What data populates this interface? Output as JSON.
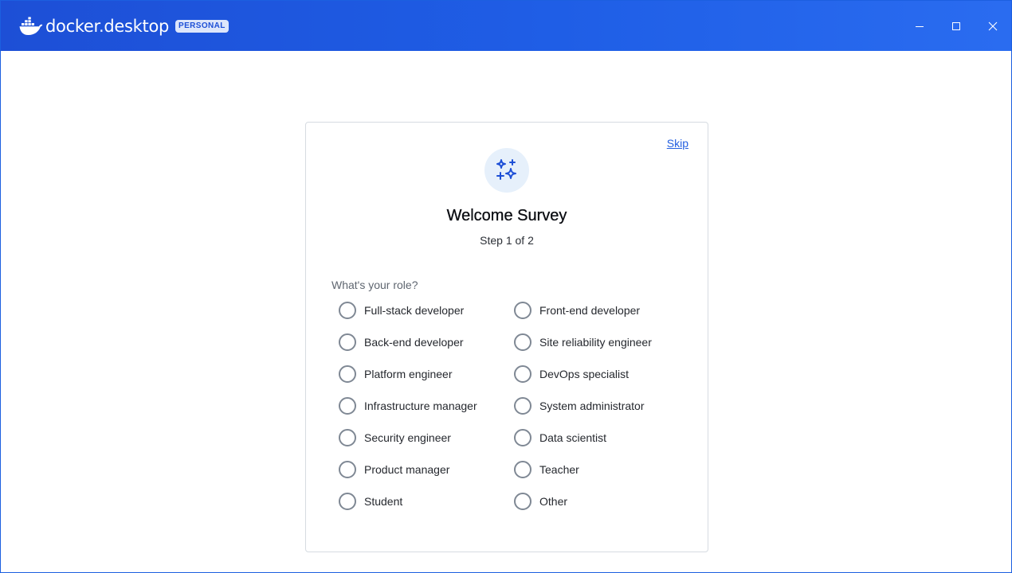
{
  "app": {
    "brand_name": "docker",
    "brand_product": "desktop",
    "plan_badge": "PERSONAL",
    "accent": "#1d4fd6"
  },
  "window_controls": {
    "minimize_icon": "minimize-icon",
    "maximize_icon": "maximize-icon",
    "close_icon": "close-icon"
  },
  "survey": {
    "skip_label": "Skip",
    "icon": "sparkles-icon",
    "title": "Welcome Survey",
    "step": "Step 1 of 2",
    "question": "What's your role?",
    "options": [
      "Full-stack developer",
      "Front-end developer",
      "Back-end developer",
      "Site reliability engineer",
      "Platform engineer",
      "DevOps specialist",
      "Infrastructure manager",
      "System administrator",
      "Security engineer",
      "Data scientist",
      "Product manager",
      "Teacher",
      "Student",
      "Other"
    ]
  }
}
